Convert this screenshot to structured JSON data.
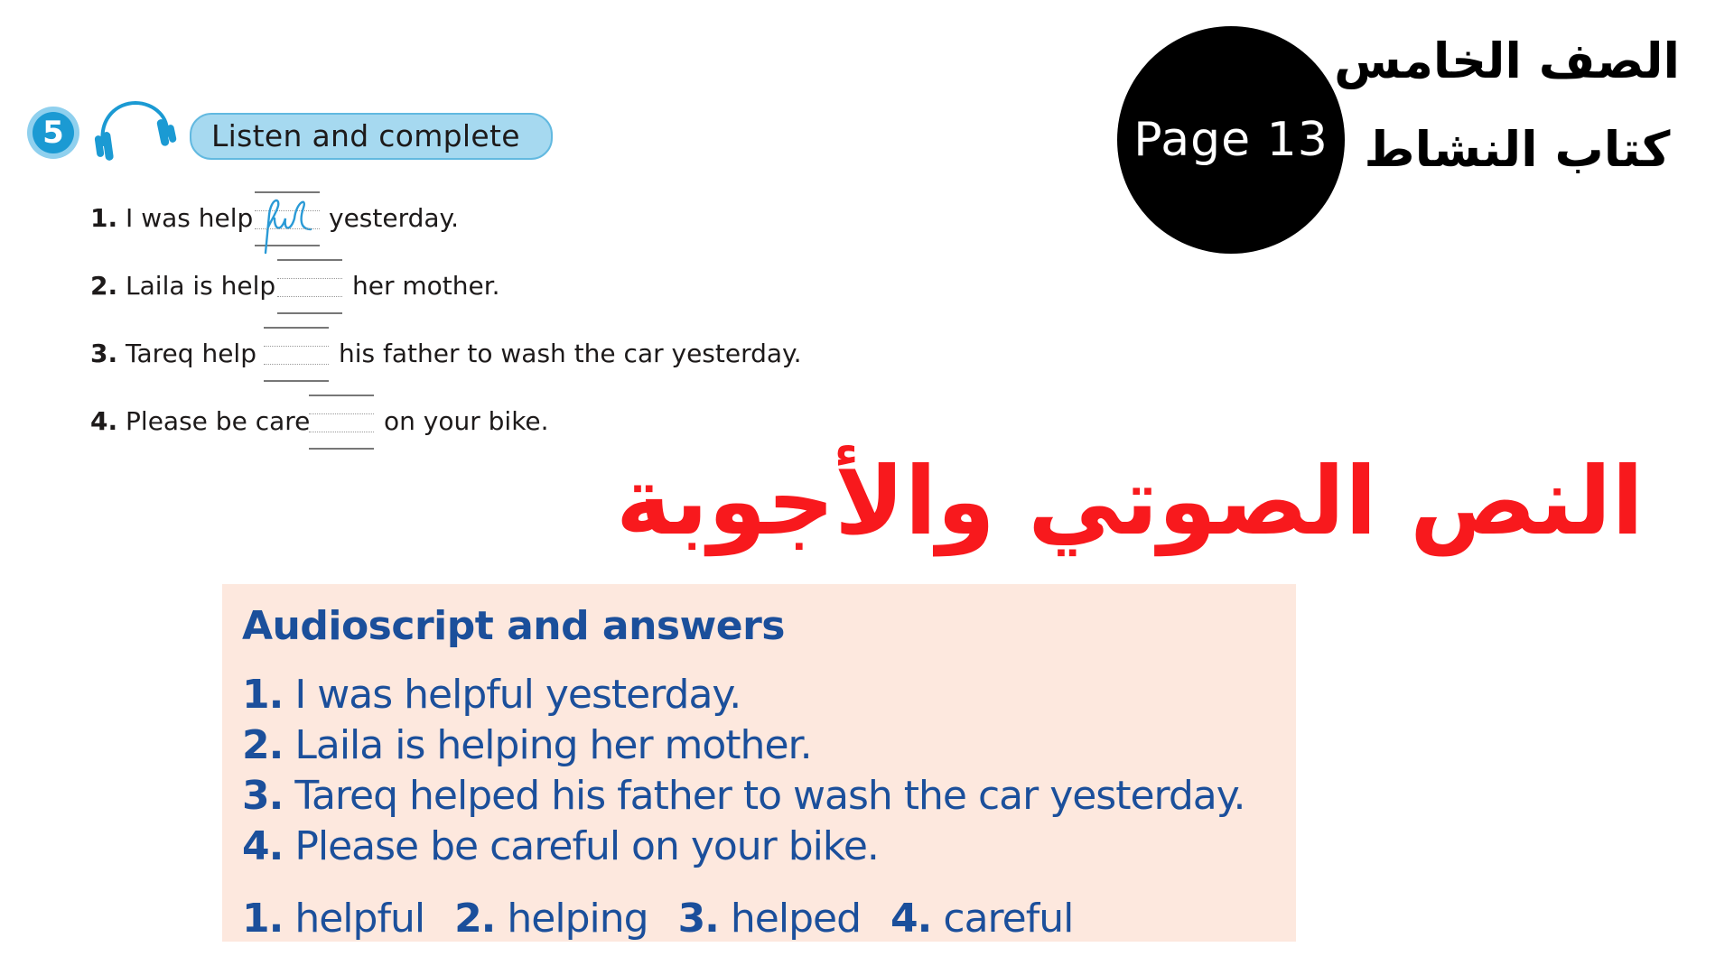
{
  "exercise": {
    "number": "5",
    "instruction": "Listen and complete",
    "items": [
      {
        "num": "1.",
        "before": "I was help",
        "after": "yesterday.",
        "filled": "ful"
      },
      {
        "num": "2.",
        "before": "Laila is help",
        "after": "her mother.",
        "filled": ""
      },
      {
        "num": "3.",
        "before": "Tareq help",
        "after": "his father to wash the car yesterday.",
        "filled": ""
      },
      {
        "num": "4.",
        "before": "Please be care",
        "after": "on your bike.",
        "filled": ""
      }
    ]
  },
  "header": {
    "page_label": "Page 13",
    "grade": "الصف الخامس",
    "book": "كتاب النشاط"
  },
  "red_title": "النص الصوتي والأجوبة",
  "answer_box": {
    "title": "Audioscript and answers",
    "lines": [
      {
        "num": "1.",
        "text": "I was helpful yesterday."
      },
      {
        "num": "2.",
        "text": "Laila is helping her mother."
      },
      {
        "num": "3.",
        "text": "Tareq helped his father to wash the car yesterday."
      },
      {
        "num": "4.",
        "text": "Please be careful on your bike."
      }
    ],
    "answers": [
      {
        "num": "1.",
        "word": "helpful"
      },
      {
        "num": "2.",
        "word": "helping"
      },
      {
        "num": "3.",
        "word": "helped"
      },
      {
        "num": "4.",
        "word": "careful"
      }
    ]
  },
  "colors": {
    "badge": "#1b9ad3",
    "instruction_bg": "#a6d9f0",
    "red_title": "#f8191d",
    "answer_text": "#1b4f9b",
    "answer_bg": "#fde8de"
  }
}
